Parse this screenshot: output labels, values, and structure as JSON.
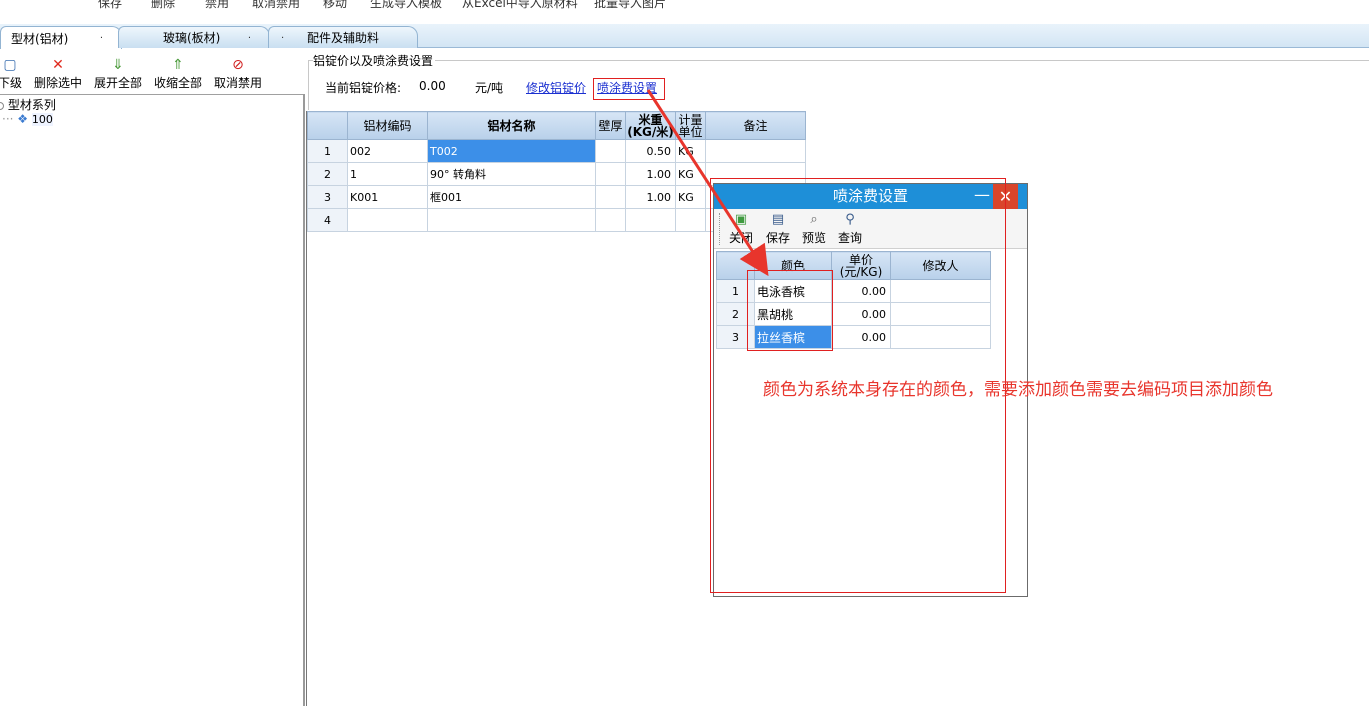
{
  "toolbar": {
    "items": [
      "保存",
      "删除",
      "禁用",
      "取消禁用",
      "移动",
      "生成导入模板",
      "从Excel中导入原材料",
      "批量导入图片"
    ]
  },
  "tabs": [
    {
      "label": "型材(铝材)",
      "active": true
    },
    {
      "label": "玻璃(板材)",
      "active": false
    },
    {
      "label": "配件及辅助料",
      "active": false
    }
  ],
  "tab_dot": ".",
  "left_toolbar": {
    "items": [
      {
        "label": "下级",
        "icon": "add-child-icon"
      },
      {
        "label": "删除选中",
        "icon": "delete-x-icon"
      },
      {
        "label": "展开全部",
        "icon": "expand-icon"
      },
      {
        "label": "收缩全部",
        "icon": "collapse-icon"
      },
      {
        "label": "取消禁用",
        "icon": "unban-icon"
      }
    ]
  },
  "tree": {
    "root": "型材系列",
    "children": [
      "100"
    ]
  },
  "ingot": {
    "group_title": "铝锭价以及喷涂费设置",
    "price_label": "当前铝锭价格:",
    "price_value": "0.00",
    "unit": "元/吨",
    "edit_link": "修改铝锭价",
    "spray_link": "喷涂费设置"
  },
  "material_grid": {
    "columns": [
      "铝材编码",
      "铝材名称",
      "壁厚",
      "米重\n(KG/米)",
      "计量\n单位",
      "备注"
    ],
    "rows": [
      {
        "n": "1",
        "code": "002",
        "name": "T002",
        "thick": "",
        "weight": "0.50",
        "unit": "KG",
        "note": ""
      },
      {
        "n": "2",
        "code": "1",
        "name": "90° 转角料",
        "thick": "",
        "weight": "1.00",
        "unit": "KG",
        "note": ""
      },
      {
        "n": "3",
        "code": "K001",
        "name": "框001",
        "thick": "",
        "weight": "1.00",
        "unit": "KG",
        "note": ""
      },
      {
        "n": "4",
        "code": "",
        "name": "",
        "thick": "",
        "weight": "",
        "unit": "",
        "note": ""
      }
    ]
  },
  "dialog": {
    "title": "喷涂费设置",
    "minimize": "—",
    "close": "✕",
    "toolbar": [
      {
        "label": "关闭",
        "icon": "close-door-icon"
      },
      {
        "label": "保存",
        "icon": "save-icon"
      },
      {
        "label": "预览",
        "icon": "preview-icon"
      },
      {
        "label": "查询",
        "icon": "query-icon"
      }
    ],
    "columns": [
      "颜色",
      "单价\n(元/KG)",
      "修改人"
    ],
    "rows": [
      {
        "n": "1",
        "color": "电泳香槟",
        "price": "0.00",
        "editor": ""
      },
      {
        "n": "2",
        "color": "黑胡桃",
        "price": "0.00",
        "editor": ""
      },
      {
        "n": "3",
        "color": "拉丝香槟",
        "price": "0.00",
        "editor": ""
      }
    ]
  },
  "annotation": {
    "note": "颜色为系统本身存在的颜色，需要添加颜色需要去编码项目添加颜色",
    "color": "#e8352c"
  }
}
